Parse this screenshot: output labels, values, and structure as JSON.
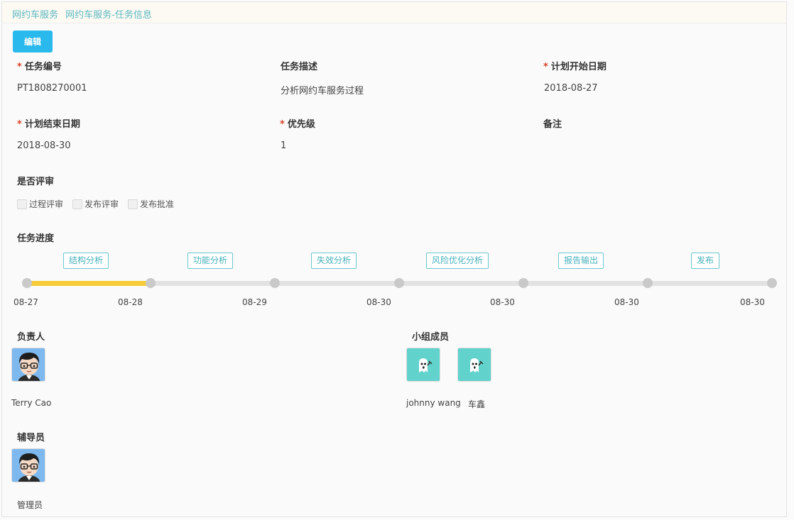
{
  "breadcrumb": [
    "网约车服务",
    "网约车服务-任务信息"
  ],
  "toolbar": {
    "edit_label": "编辑"
  },
  "fields": {
    "task_no": {
      "label": "任务编号",
      "value": "PT1808270001",
      "required": true
    },
    "task_desc": {
      "label": "任务描述",
      "value": "分析网约车服务过程",
      "required": false
    },
    "plan_start": {
      "label": "计划开始日期",
      "value": "2018-08-27",
      "required": true
    },
    "plan_end": {
      "label": "计划结束日期",
      "value": "2018-08-30",
      "required": true
    },
    "priority": {
      "label": "优先级",
      "value": "1",
      "required": true
    },
    "remark": {
      "label": "备注",
      "value": "",
      "required": false
    }
  },
  "review": {
    "label": "是否评审",
    "options": [
      {
        "label": "过程评审",
        "checked": false
      },
      {
        "label": "发布评审",
        "checked": false
      },
      {
        "label": "发布批准",
        "checked": false
      }
    ]
  },
  "progress": {
    "label": "任务进度",
    "stages": [
      "结构分析",
      "功能分析",
      "失效分析",
      "风险优化分析",
      "报告输出",
      "发布"
    ],
    "dates": [
      "08-27",
      "08-28",
      "08-29",
      "08-30",
      "08-30",
      "08-30",
      "08-30"
    ],
    "completed_fraction": 0.1667,
    "fill_color": "#f7cc36",
    "track_color": "#e2e2e2"
  },
  "owner": {
    "label": "负责人",
    "people": [
      {
        "name": "Terry Cao",
        "avatar": "cartoon-boy-avatar"
      }
    ]
  },
  "members": {
    "label": "小组成员",
    "people": [
      {
        "name": "johnny wang",
        "avatar": "ghost-avatar"
      },
      {
        "name": "车鑫",
        "avatar": "ghost-avatar"
      }
    ]
  },
  "mentor": {
    "label": "辅导员",
    "people": [
      {
        "name": "管理员",
        "avatar": "cartoon-boy-avatar"
      }
    ]
  },
  "colors": {
    "accent": "#2ab9ec",
    "link": "#5cb8c0",
    "required": "#d9412b",
    "stage_border": "#6cc6cc"
  }
}
